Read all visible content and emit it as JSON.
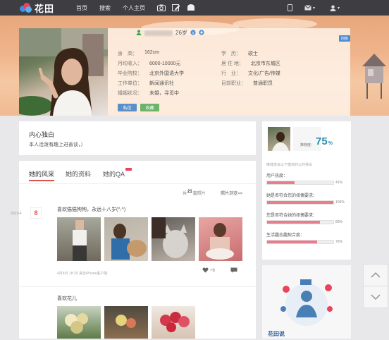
{
  "brand": {
    "name": "花田"
  },
  "nav": {
    "items": [
      "首页",
      "搜索",
      "个人主页"
    ]
  },
  "profile": {
    "age": "26岁",
    "edit_badge": "四级",
    "fields": [
      {
        "label": "身　高：",
        "value": "162cm"
      },
      {
        "label": "月均收入：",
        "value": "6000-10000元"
      },
      {
        "label": "毕业院校：",
        "value": "北京外国语大学"
      },
      {
        "label": "工作单位：",
        "value": "新闻通讯社"
      },
      {
        "label": "婚姻状况：",
        "value": "未婚，寻觅中"
      }
    ],
    "fields_right": [
      {
        "label": "学　历：",
        "value": "硕士"
      },
      {
        "label": "居 住 地：",
        "value": "北京市东城区"
      },
      {
        "label": "行　业：",
        "value": "文化/广告/传媒"
      },
      {
        "label": "目前职业：",
        "value": "普通职员"
      }
    ],
    "btn_message": "私信",
    "btn_favorite": "收藏"
  },
  "monologue": {
    "title": "内心独白",
    "text": "本人活泼有趣上进善谈，）"
  },
  "tabs": [
    "她的风采",
    "她的资料",
    "她的QA"
  ],
  "feed": {
    "summary_prefix": "共",
    "count": "21",
    "summary_suffix": "篇照片",
    "browse": "照片浏览>>",
    "date": "2013-4",
    "day": "8",
    "post1_text": "喜欢猫猫狗狗，永远十八岁(^.^)",
    "post1_meta": "4月8日 18:29 来自iPhone客户端",
    "likes": "+6",
    "post2_text": "喜欢花儿"
  },
  "match": {
    "label": "推荐度：",
    "score": "75",
    "unit": "%",
    "hint": "推荐度会以下模块的公共得出",
    "items": [
      {
        "label": "用户热度：",
        "percent": "41%",
        "value": 0.41
      },
      {
        "label": "她是否符合您的择偶要求：",
        "percent": "100%",
        "value": 1.0
      },
      {
        "label": "您是否符合她的择偶要求：",
        "percent": "80%",
        "value": 0.8
      },
      {
        "label": "生活趣志趣契合度：",
        "percent": "75%",
        "value": 0.75
      }
    ]
  },
  "ad": {
    "text": "花田说"
  },
  "colors": {
    "accent": "#d9534f",
    "topbar": "#3d3d42",
    "badge": "#4a8fd6",
    "bar_fill": "#e87d8c"
  }
}
